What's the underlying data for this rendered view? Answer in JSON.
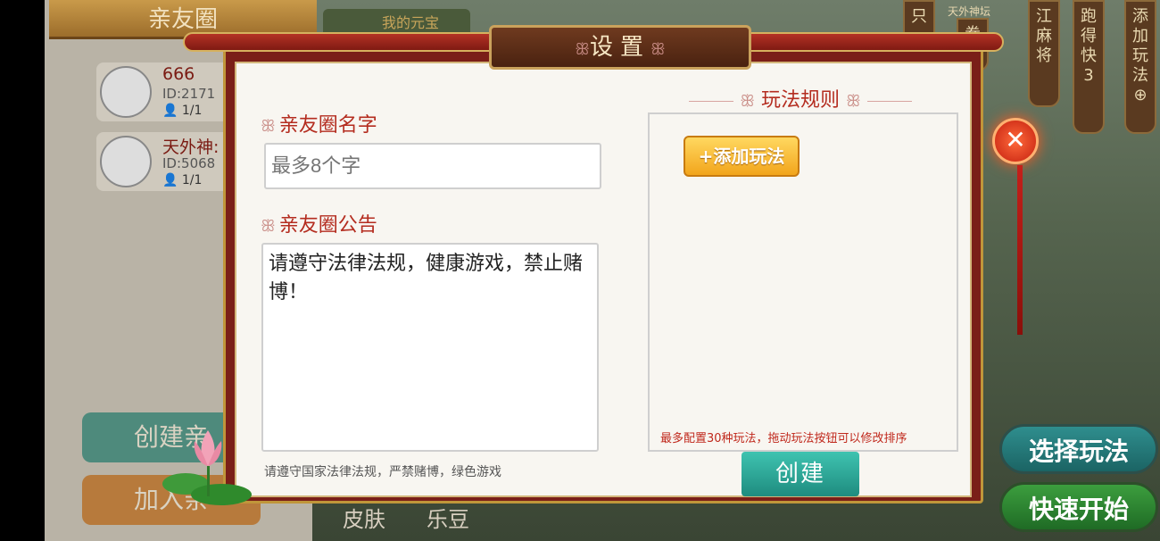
{
  "left_panel": {
    "title": "亲友圈",
    "members": [
      {
        "name": "666",
        "id": "ID:2171",
        "count": "1/1"
      },
      {
        "name": "天外神:",
        "id": "ID:5068",
        "count": "1/1"
      }
    ],
    "create_btn": "创建亲",
    "join_btn": "加入亲"
  },
  "top": {
    "ingot_label": "我的元宝",
    "tabs": [
      "只",
      "拳",
      "江麻将",
      "跑得快",
      "添加玩法"
    ],
    "tab_top_label": "天外神坛",
    "paodekuai_count": "3"
  },
  "modal": {
    "title": "设置",
    "name_label": "亲友圈名字",
    "name_placeholder": "最多8个字",
    "notice_label": "亲友圈公告",
    "notice_value": "请遵守法律法规，健康游戏，禁止赌博！",
    "notice_hint": "请遵守国家法律法规，严禁赌博，绿色游戏",
    "rules_title": "玩法规则",
    "add_rule_btn": "+添加玩法",
    "rules_note": "最多配置30种玩法，拖动玩法按钮可以修改排序",
    "create_btn": "创建",
    "deco_glyph": "ꕥ"
  },
  "right": {
    "select_btn": "选择玩法",
    "quick_btn": "快速开始"
  },
  "bottom_tabs": [
    "皮肤",
    "乐豆"
  ],
  "colors": {
    "accent_red": "#b42c1f",
    "gold": "#f2a51c",
    "teal": "#1e8c7f"
  }
}
